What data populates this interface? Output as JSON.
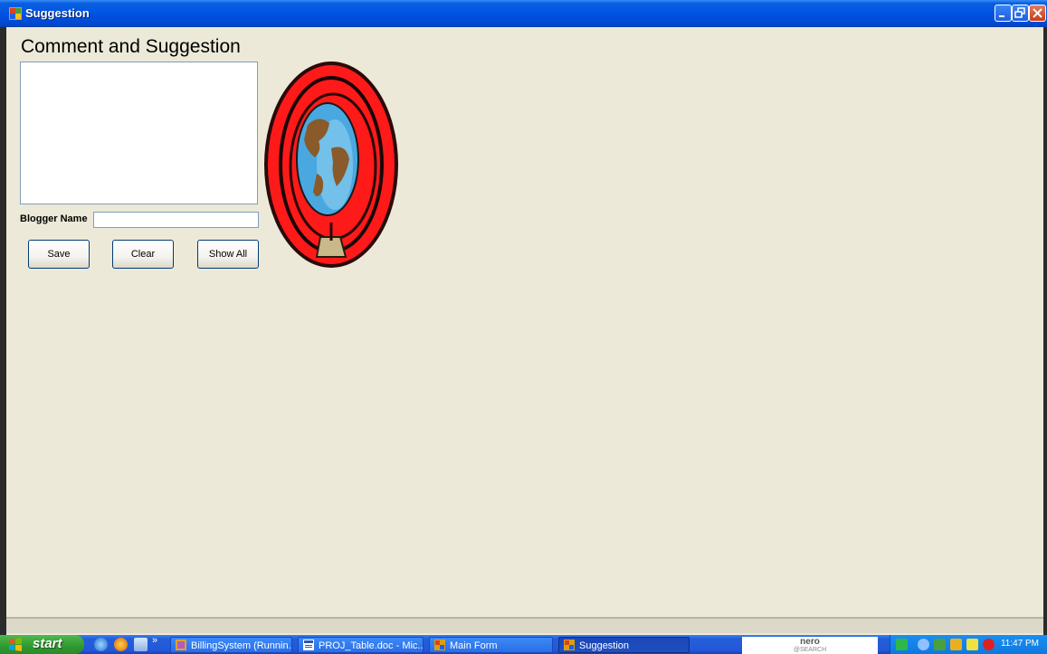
{
  "window": {
    "title": "Suggestion"
  },
  "form": {
    "heading": "Comment and Suggestion",
    "comment_value": "",
    "blogger_label": "Blogger Name",
    "blogger_value": "",
    "buttons": {
      "save": "Save",
      "clear": "Clear",
      "show_all": "Show All"
    }
  },
  "taskbar": {
    "start_label": "start",
    "quick_launch_more": "»",
    "tasks": [
      {
        "label": "BillingSystem (Runnin..."
      },
      {
        "label": "PROJ_Table.doc - Mic..."
      },
      {
        "label": "Main Form"
      },
      {
        "label": "Suggestion"
      }
    ],
    "nero": {
      "line1": "nero",
      "line2": "@SEARCH"
    },
    "clock": "11:47 PM"
  },
  "colors": {
    "titlebar": "#0054e3",
    "form_bg": "#ece9d8",
    "taskbar": "#245edb",
    "start_green": "#3c9f3c"
  }
}
